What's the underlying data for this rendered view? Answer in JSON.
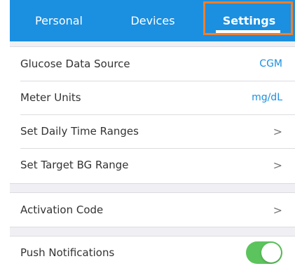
{
  "tabs": [
    {
      "label": "Personal"
    },
    {
      "label": "Devices"
    },
    {
      "label": "Settings",
      "active": true
    }
  ],
  "colors": {
    "header": "#1b8fe0",
    "highlight": "#f07f2c",
    "toggle_on": "#5cc45c",
    "value_text": "#1b8fe0"
  },
  "settings": {
    "glucose_data_source": {
      "label": "Glucose Data Source",
      "value": "CGM"
    },
    "meter_units": {
      "label": "Meter Units",
      "value": "mg/dL"
    },
    "daily_time_ranges": {
      "label": "Set Daily Time Ranges",
      "icon": "chevron-right-icon"
    },
    "target_bg_range": {
      "label": "Set Target BG Range",
      "icon": "chevron-right-icon"
    },
    "activation_code": {
      "label": "Activation Code",
      "icon": "chevron-right-icon"
    },
    "push_notifications": {
      "label": "Push Notifications",
      "enabled": true
    }
  }
}
